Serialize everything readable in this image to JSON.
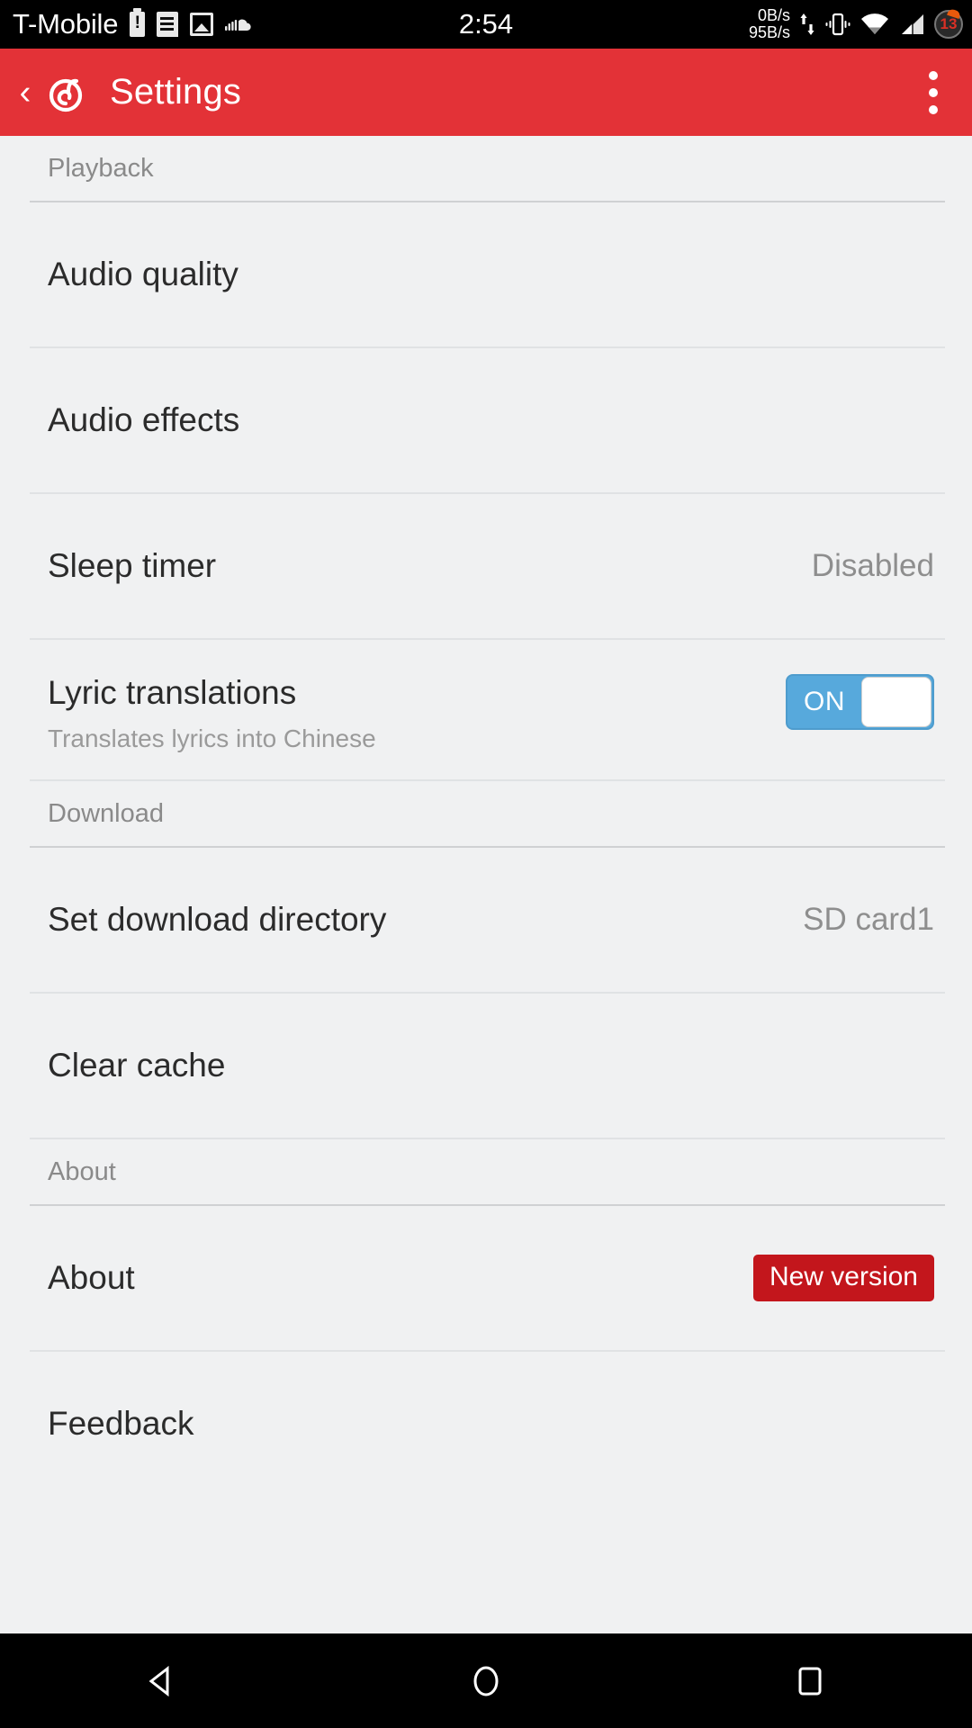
{
  "status_bar": {
    "carrier": "T-Mobile",
    "clock": "2:54",
    "net_up": "0B/s",
    "net_down": "95B/s",
    "battery_level": "13",
    "icons": [
      "battery-alert-icon",
      "message-icon",
      "image-icon",
      "soundcloud-icon",
      "data-transfer-icon",
      "vibrate-icon",
      "wifi-icon",
      "cellular-signal-icon",
      "battery-circle-icon"
    ]
  },
  "app_bar": {
    "back_label": "‹",
    "logo": "netease-cloud-music-logo",
    "title": "Settings",
    "overflow_label": "more-options"
  },
  "sections": [
    {
      "header": "Playback",
      "rows": [
        {
          "title": "Audio quality",
          "value": "",
          "sub": "",
          "control": "none"
        },
        {
          "title": "Audio effects",
          "value": "",
          "sub": "",
          "control": "none"
        },
        {
          "title": "Sleep timer",
          "value": "Disabled",
          "sub": "",
          "control": "value"
        },
        {
          "title": "Lyric translations",
          "value": "",
          "sub": "Translates lyrics into Chinese",
          "control": "switch",
          "switch_state": "ON"
        }
      ]
    },
    {
      "header": "Download",
      "rows": [
        {
          "title": "Set download directory",
          "value": "SD card1",
          "sub": "",
          "control": "value"
        },
        {
          "title": "Clear cache",
          "value": "",
          "sub": "",
          "control": "none"
        }
      ]
    },
    {
      "header": "About",
      "rows": [
        {
          "title": "About",
          "value": "",
          "sub": "",
          "control": "badge",
          "badge": "New version"
        },
        {
          "title": "Feedback",
          "value": "",
          "sub": "",
          "control": "none"
        }
      ]
    }
  ],
  "nav_bar": {
    "back": "back-triangle",
    "home": "home-circle",
    "recents": "recents-square"
  },
  "colors": {
    "app_bar": "#E33237",
    "background": "#F0F1F2",
    "switch_on": "#57A9DC",
    "badge": "#C3161C",
    "primary_text": "#2B2B2B",
    "secondary_text": "#8E8E8E"
  }
}
